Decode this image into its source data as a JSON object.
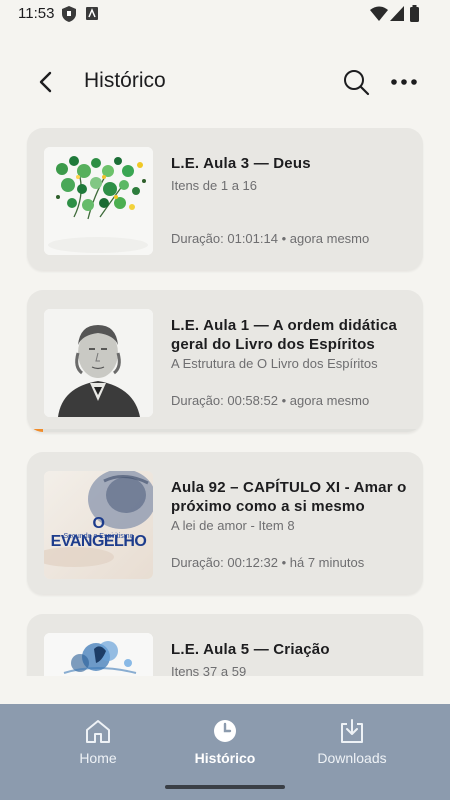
{
  "status_bar": {
    "time": "11:53"
  },
  "header": {
    "title": "Histórico"
  },
  "history": [
    {
      "title": "L.E. Aula 3 — Deus",
      "subtitle": "Itens de 1 a 16",
      "duration_label": "Duração: 01:01:14",
      "when": "agora mesmo",
      "progress": 0
    },
    {
      "title": "L.E. Aula 1 — A ordem didática geral do Livro dos Espíritos",
      "subtitle": "A Estrutura de O Livro dos Espíritos",
      "duration_label": "Duração: 00:58:52",
      "when": "agora mesmo",
      "progress": 0.04
    },
    {
      "title": "Aula 92 – CAPÍTULO XI - Amar o próximo como a si mesmo",
      "subtitle": "A lei de amor - Item 8",
      "duration_label": "Duração: 00:12:32",
      "when": "há 7 minutos",
      "progress": 0
    },
    {
      "title": "L.E. Aula 5 — Criação",
      "subtitle": "Itens 37 a 59",
      "duration_label": "",
      "when": "",
      "progress": 0
    }
  ],
  "thumb_text": {
    "evangelho_title": "O EVANGELHO",
    "evangelho_subtitle": "Segundo o Espiritismo"
  },
  "bottom_nav": [
    {
      "label": "Home",
      "icon": "home-icon",
      "active": false
    },
    {
      "label": "Histórico",
      "icon": "clock-icon",
      "active": true
    },
    {
      "label": "Downloads",
      "icon": "download-icon",
      "active": false
    }
  ],
  "colors": {
    "background": "#f5f4f0",
    "card": "#e8e7e3",
    "progress": "#f08c2a",
    "nav": "#8c9bae"
  }
}
